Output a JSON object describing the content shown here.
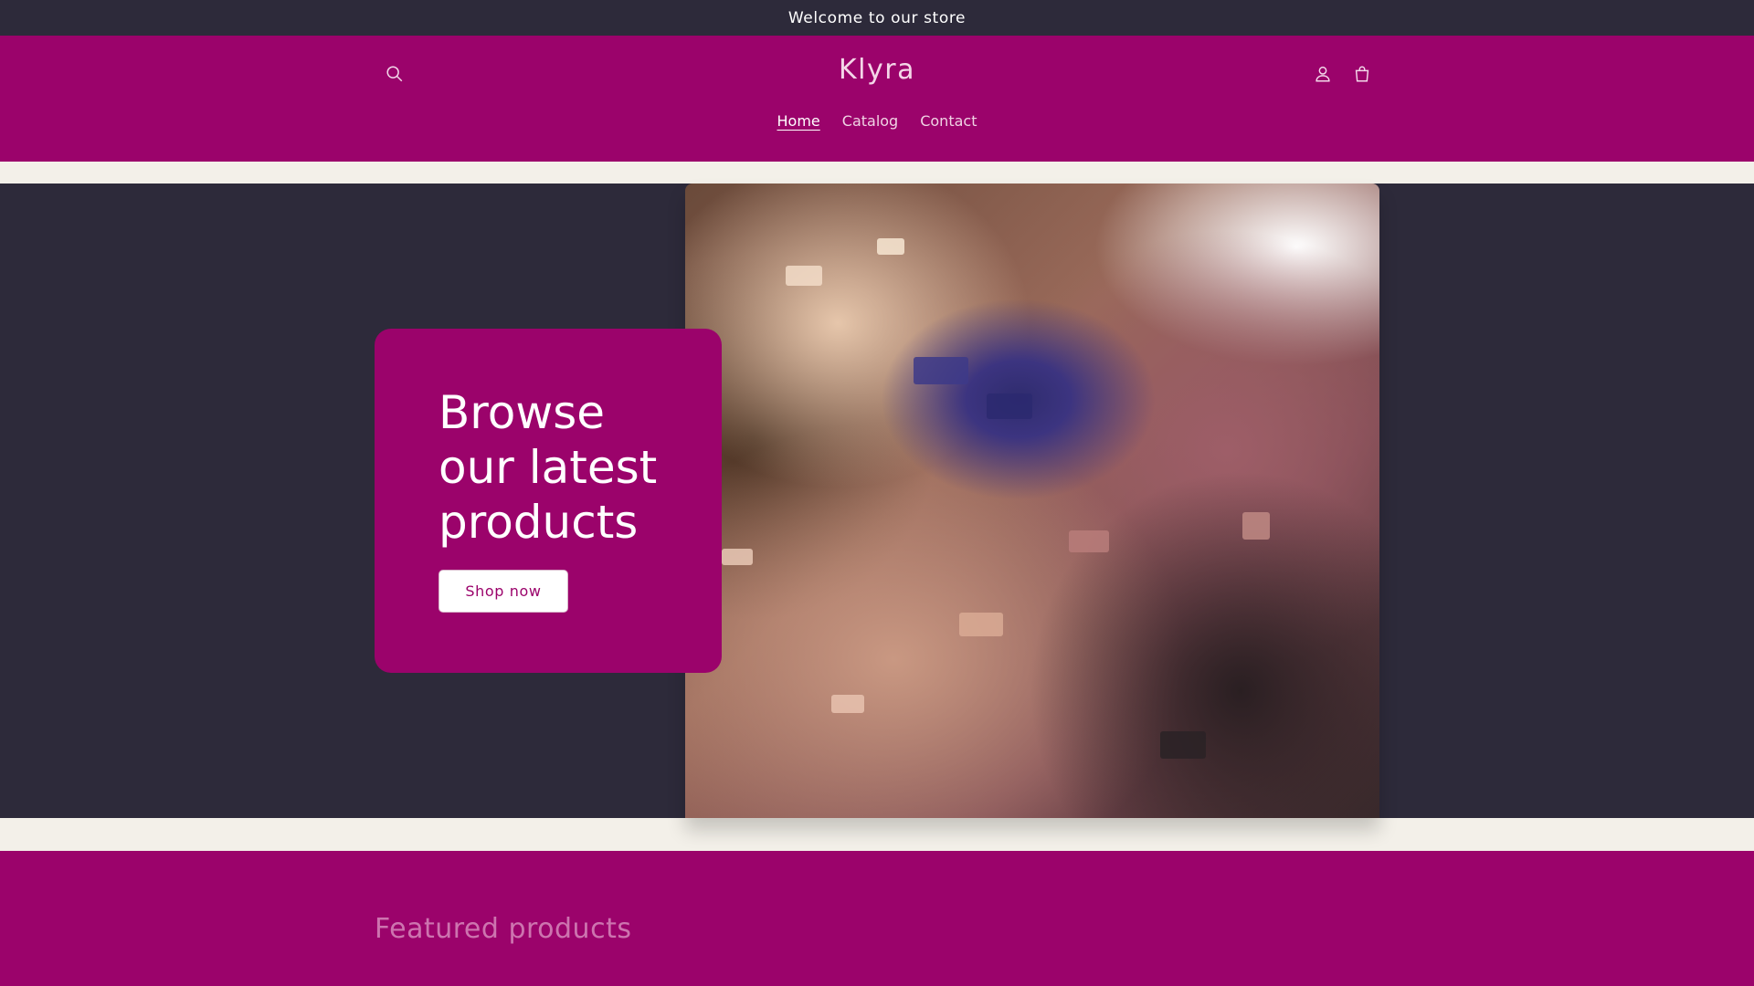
{
  "announcement": {
    "text": "Welcome to our store"
  },
  "header": {
    "logo": "Klyra",
    "nav": [
      {
        "label": "Home",
        "active": true
      },
      {
        "label": "Catalog",
        "active": false
      },
      {
        "label": "Contact",
        "active": false
      }
    ],
    "icons": {
      "search": "search-icon",
      "account": "user-icon",
      "cart": "cart-icon"
    }
  },
  "hero": {
    "title": "Browse our latest products",
    "button_label": "Shop now",
    "image": "crushed-makeup-powder"
  },
  "featured": {
    "title": "Featured products"
  },
  "colors": {
    "brand": "#9b036b",
    "dark": "#2d2a3a",
    "cream": "#f3f0e9"
  }
}
